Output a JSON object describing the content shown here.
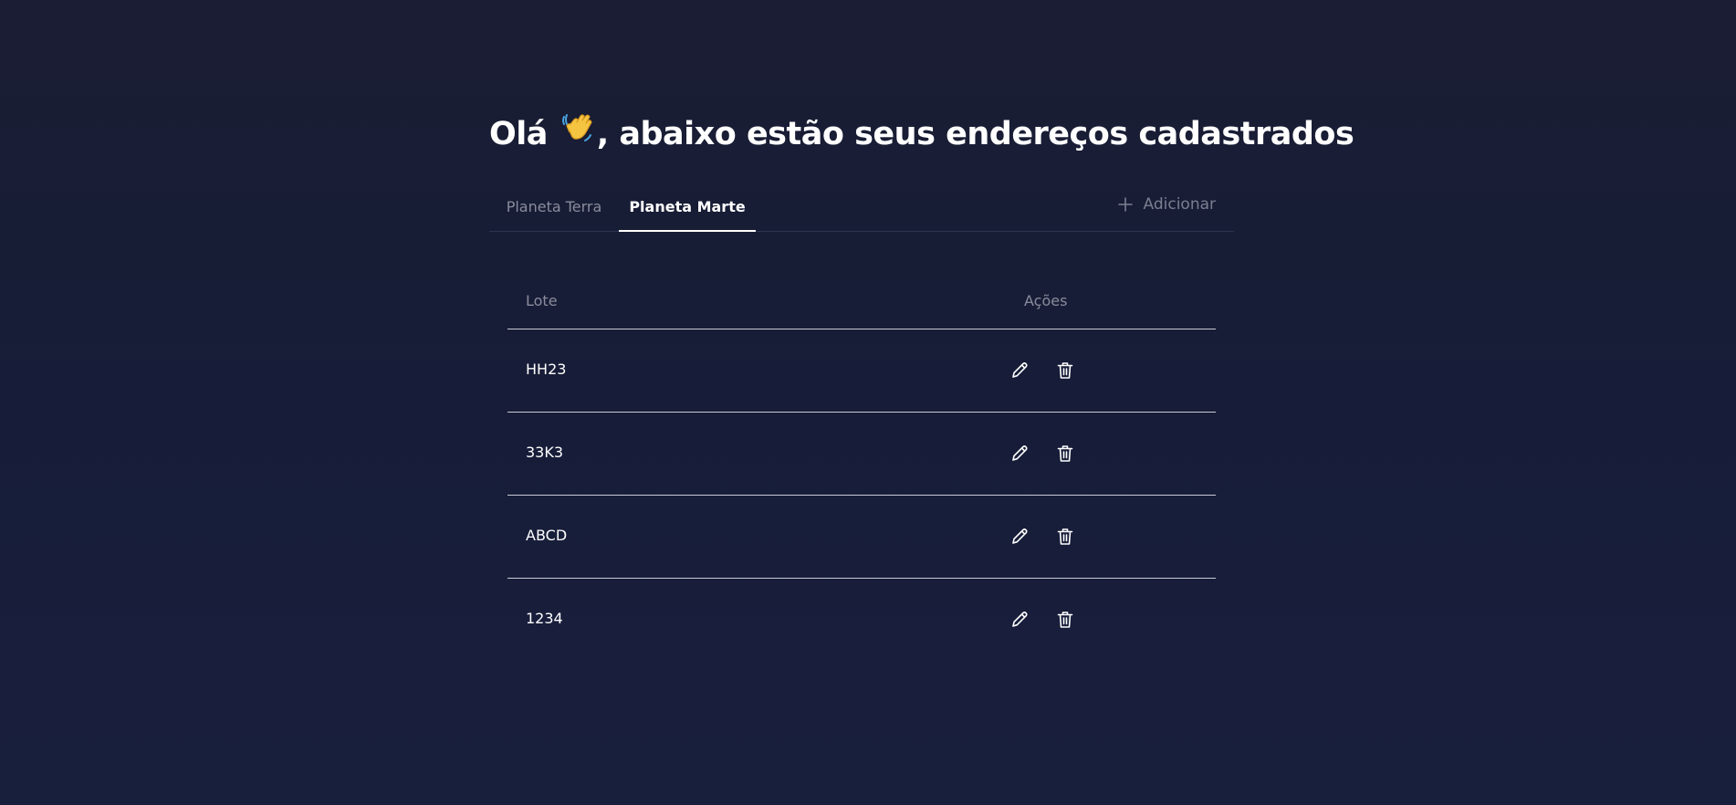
{
  "header": {
    "title_prefix": "Olá",
    "title_suffix": ", abaixo estão seus endereços cadastrados",
    "wave_icon": "wave-hand-icon"
  },
  "tabs": [
    {
      "label": "Planeta Terra",
      "active": false
    },
    {
      "label": "Planeta Marte",
      "active": true
    }
  ],
  "add_button": {
    "label": "Adicionar",
    "icon": "plus-icon"
  },
  "table": {
    "columns": {
      "lote": "Lote",
      "acoes": "Ações"
    },
    "rows": [
      {
        "lote": "HH23"
      },
      {
        "lote": "33K3"
      },
      {
        "lote": "ABCD"
      },
      {
        "lote": "1234"
      }
    ],
    "row_actions": [
      "edit-icon",
      "trash-icon"
    ]
  },
  "colors": {
    "background": "#171d38",
    "text_primary": "#ffffff",
    "text_muted": "#8a8c9c",
    "divider": "#c9cbd6",
    "wave_hand": "#f5c542"
  }
}
